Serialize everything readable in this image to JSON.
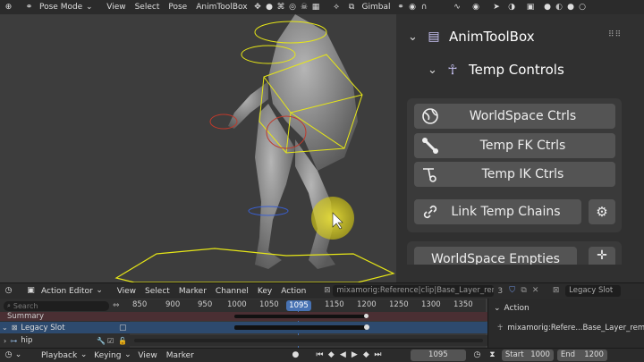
{
  "top_menu": {
    "mode": "Pose Mode",
    "items": [
      "View",
      "Select",
      "Pose",
      "AnimToolBox"
    ],
    "orientation": "Gimbal"
  },
  "npanel": {
    "title": "AnimToolBox",
    "section": "Temp Controls",
    "buttons": {
      "worldspace_ctrls": "WorldSpace Ctrls",
      "temp_fk": "Temp FK Ctrls",
      "temp_ik": "Temp IK Ctrls",
      "link_chains": "Link Temp Chains",
      "worldspace_empties": "WorldSpace Empties"
    }
  },
  "action_editor": {
    "mode": "Action Editor",
    "menu": [
      "View",
      "Select",
      "Marker",
      "Channel",
      "Key",
      "Action"
    ],
    "action_name": "mixamorig:Reference|clip|Base_Layer_remap",
    "users": "3",
    "slot": "Legacy Slot",
    "search_placeholder": "Search",
    "ruler": [
      "850",
      "900",
      "950",
      "1000",
      "1050",
      "1100",
      "1150",
      "1200",
      "1250",
      "1300",
      "1350"
    ],
    "current_frame": "1095",
    "channels": {
      "summary": "Summary",
      "slot": "Legacy Slot",
      "bone": "hip"
    }
  },
  "sidebar": {
    "section": "Action",
    "action": "mixamorig:Refere...Base_Layer_remap"
  },
  "playback_bar": {
    "items": [
      "Playback",
      "Keying",
      "View",
      "Marker"
    ],
    "frame": "1095",
    "start_label": "Start",
    "start": "1000",
    "end_label": "End",
    "end": "1200"
  },
  "colors": {
    "accent": "#4772b3",
    "button": "#545454",
    "panel": "#303030",
    "rig": "#e6e617"
  }
}
